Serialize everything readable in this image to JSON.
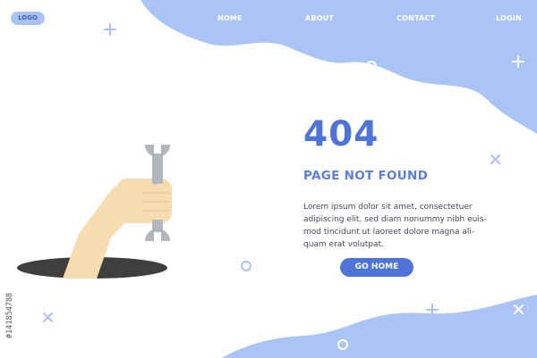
{
  "header": {
    "logo": "LOGO",
    "nav": [
      {
        "label": "HOME"
      },
      {
        "label": "ABOUT"
      },
      {
        "label": "CONTACT"
      },
      {
        "label": "LOGIN"
      }
    ]
  },
  "error": {
    "code": "404",
    "title": "PAGE NOT FOUND",
    "body_lines": [
      "Lorem ipsum dolor sit amet, consectetuer",
      "adipiscing elit, sed diam nonummy nibh euis-",
      "mod tincidunt ut laoreet dolore magna ali-",
      "quam erat volutpat."
    ],
    "button": "GO HOME"
  },
  "stock_id": "#141854788",
  "colors": {
    "blob": "#aac5f5",
    "accent": "#4f74d8",
    "hole": "#3f3f3f",
    "skin": "#f6dcae",
    "wrench": "#b3b6be"
  },
  "icons": [
    "plus-icon",
    "circle-icon",
    "x-icon",
    "wrench-icon",
    "hand-icon"
  ]
}
